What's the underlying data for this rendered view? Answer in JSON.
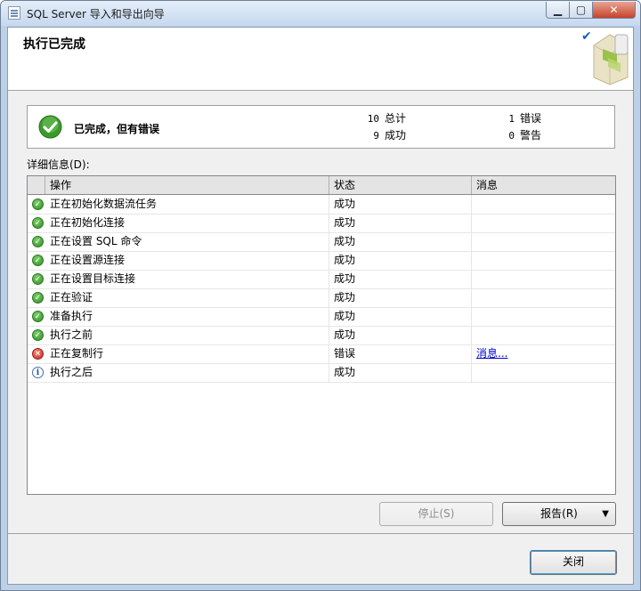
{
  "window": {
    "title": "SQL Server 导入和导出向导",
    "minimize_glyph": "▁",
    "maximize_glyph": "▢",
    "close_glyph": "✕"
  },
  "header": {
    "title": "执行已完成",
    "check_icon": "checkmark-icon"
  },
  "summary": {
    "status": "已完成，但有错误",
    "total_count": "10",
    "total_label": "总计",
    "success_count": "9",
    "success_label": "成功",
    "error_count": "1",
    "error_label": "错误",
    "warning_count": "0",
    "warning_label": "警告"
  },
  "details_label": "详细信息(D):",
  "grid": {
    "columns": [
      "操作",
      "状态",
      "消息"
    ],
    "rows": [
      {
        "icon": "success",
        "action": "正在初始化数据流任务",
        "status": "成功",
        "message": ""
      },
      {
        "icon": "success",
        "action": "正在初始化连接",
        "status": "成功",
        "message": ""
      },
      {
        "icon": "success",
        "action": "正在设置 SQL 命令",
        "status": "成功",
        "message": ""
      },
      {
        "icon": "success",
        "action": "正在设置源连接",
        "status": "成功",
        "message": ""
      },
      {
        "icon": "success",
        "action": "正在设置目标连接",
        "status": "成功",
        "message": ""
      },
      {
        "icon": "success",
        "action": "正在验证",
        "status": "成功",
        "message": ""
      },
      {
        "icon": "success",
        "action": "准备执行",
        "status": "成功",
        "message": ""
      },
      {
        "icon": "success",
        "action": "执行之前",
        "status": "成功",
        "message": ""
      },
      {
        "icon": "error",
        "action": "正在复制行",
        "status": "错误",
        "message": "消息..."
      },
      {
        "icon": "info",
        "action": "执行之后",
        "status": "成功",
        "message": ""
      }
    ]
  },
  "buttons": {
    "stop": "停止(S)",
    "report": "报告(R)",
    "close": "关闭"
  },
  "colors": {
    "success": "#2f8a24",
    "error": "#c32619",
    "info": "#3d6fb8",
    "link": "#0000cc"
  }
}
